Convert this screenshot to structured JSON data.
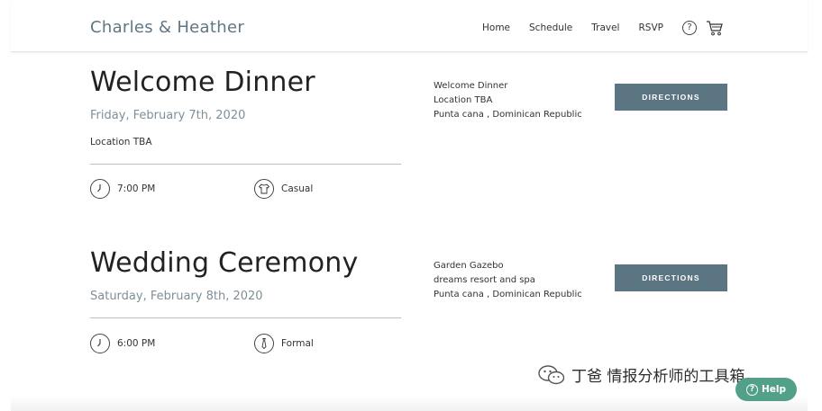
{
  "header": {
    "brand": "Charles & Heather",
    "nav": [
      "Home",
      "Schedule",
      "Travel",
      "RSVP"
    ],
    "help_glyph": "?",
    "cart_icon": "cart-icon"
  },
  "events": [
    {
      "title": "Welcome Dinner",
      "date": "Friday, February 7th, 2020",
      "location": "Location TBA",
      "time": "7:00 PM",
      "dress": "Casual",
      "dress_icon": "shirt-icon",
      "venue_lines": [
        "Welcome Dinner",
        "Location TBA",
        "Punta cana , Dominican Republic"
      ],
      "button": "DIRECTIONS"
    },
    {
      "title": "Wedding Ceremony",
      "date": "Saturday, February 8th, 2020",
      "location": "",
      "time": "6:00 PM",
      "dress": "Formal",
      "dress_icon": "tie-icon",
      "venue_lines": [
        "Garden Gazebo",
        "dreams resort and spa",
        "Punta cana , Dominican Republic"
      ],
      "button": "DIRECTIONS"
    }
  ],
  "watermark": "丁爸 情报分析师的工具箱",
  "help_button": "Help",
  "colors": {
    "accent": "#5c7582",
    "brand": "#5f7683",
    "help_green": "#52a08a"
  }
}
